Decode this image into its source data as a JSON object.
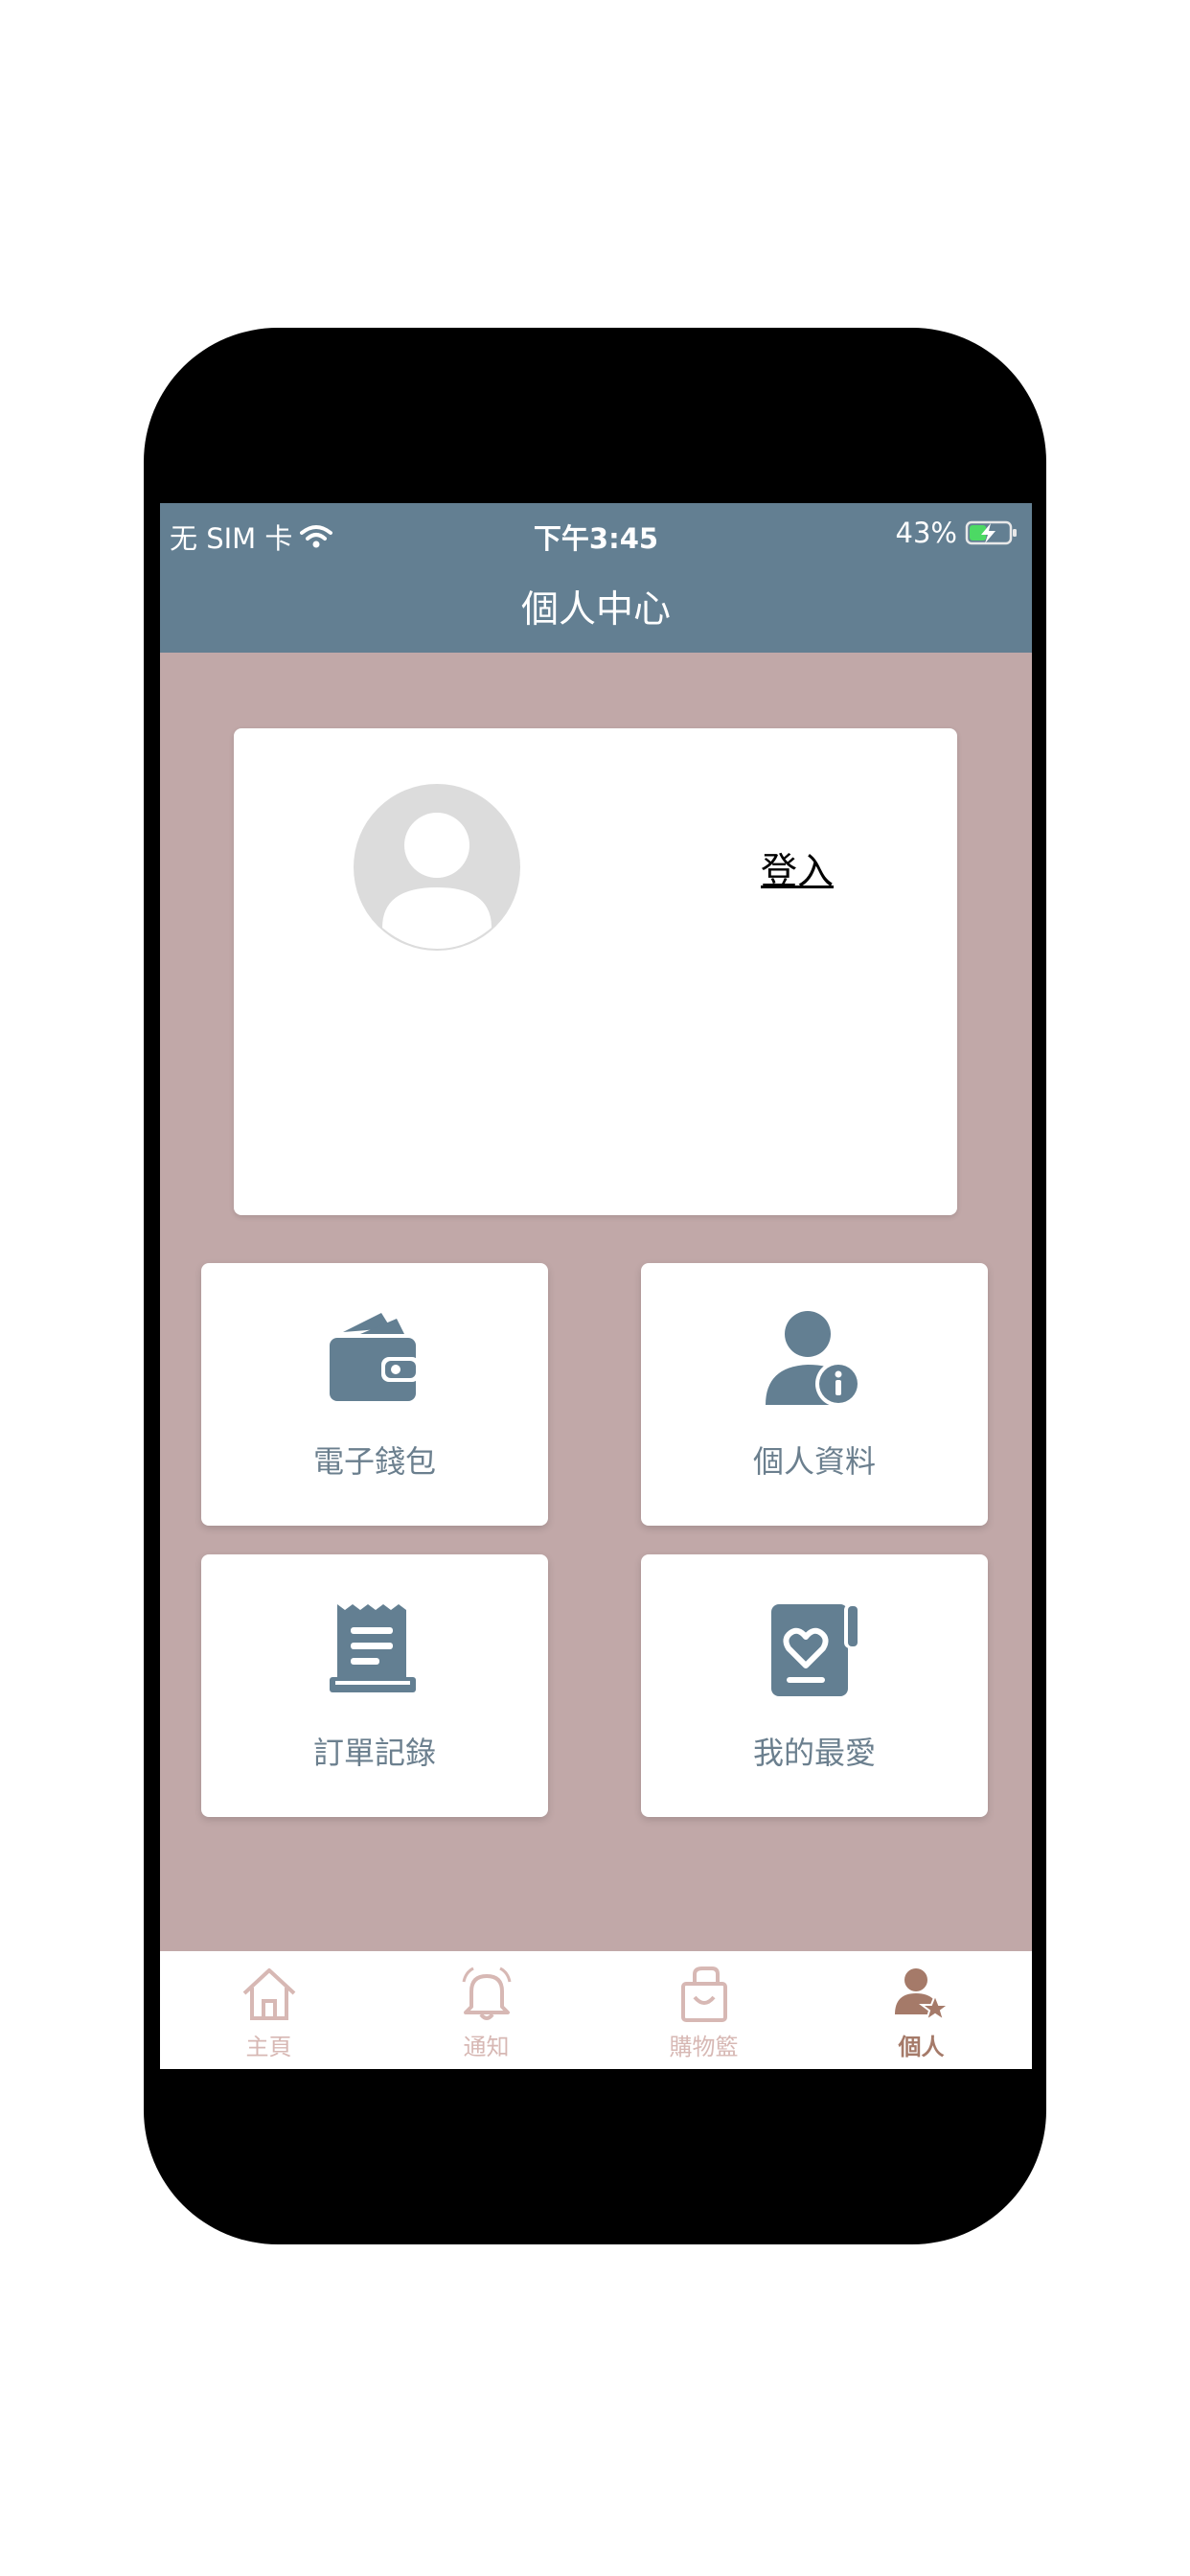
{
  "status_bar": {
    "carrier": "无 SIM 卡",
    "time": "下午3:45",
    "battery": "43%",
    "battery_level": 0.43
  },
  "nav": {
    "title": "個人中心"
  },
  "profile": {
    "login_label": "登入",
    "avatar_icon": "default-avatar-icon"
  },
  "tiles": [
    {
      "label": "電子錢包",
      "icon": "wallet-icon"
    },
    {
      "label": "個人資料",
      "icon": "user-info-icon"
    },
    {
      "label": "訂單記錄",
      "icon": "receipt-icon"
    },
    {
      "label": "我的最愛",
      "icon": "favorite-book-icon"
    }
  ],
  "tabbar": {
    "items": [
      {
        "label": "主頁",
        "icon": "home-icon",
        "active": false
      },
      {
        "label": "通知",
        "icon": "bell-icon",
        "active": false
      },
      {
        "label": "購物籃",
        "icon": "shopping-bag-icon",
        "active": false
      },
      {
        "label": "個人",
        "icon": "user-star-icon",
        "active": true
      }
    ]
  },
  "colors": {
    "header": "#637f92",
    "background": "#c1a8a8",
    "icon": "#637f92",
    "tab_inactive": "#d7b8b4",
    "tab_active": "#a57a69"
  }
}
